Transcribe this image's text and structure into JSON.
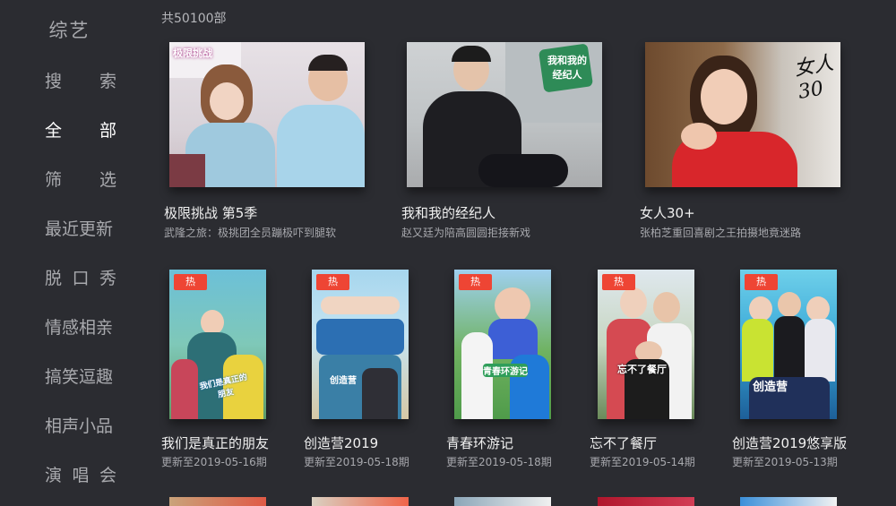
{
  "sidebar": {
    "category": "综艺",
    "items": [
      {
        "label": "搜索",
        "chars": [
          "搜",
          "索"
        ],
        "active": false
      },
      {
        "label": "全部",
        "chars": [
          "全",
          "部"
        ],
        "active": true
      },
      {
        "label": "筛选",
        "chars": [
          "筛",
          "选"
        ],
        "active": false
      },
      {
        "label": "最近更新",
        "chars": [
          "最近更新"
        ],
        "active": false
      },
      {
        "label": "脱口秀",
        "chars": [
          "脱",
          "口",
          "秀"
        ],
        "active": false
      },
      {
        "label": "情感相亲",
        "chars": [
          "情感相亲"
        ],
        "active": false
      },
      {
        "label": "搞笑逗趣",
        "chars": [
          "搞笑逗趣"
        ],
        "active": false
      },
      {
        "label": "相声小品",
        "chars": [
          "相声小品"
        ],
        "active": false
      },
      {
        "label": "演唱会",
        "chars": [
          "演",
          "唱",
          "会"
        ],
        "active": false
      }
    ]
  },
  "header": {
    "count": "共50100部"
  },
  "featured": [
    {
      "title": "极限挑战 第5季",
      "subtitle": "武隆之旅：极挑团全员蹦极吓到腿软",
      "overlay": "极限挑战"
    },
    {
      "title": "我和我的经纪人",
      "subtitle": "赵又廷为陪高圆圆拒接新戏",
      "overlay": "我和我的经纪人"
    },
    {
      "title": "女人30+",
      "subtitle": "张柏芝重回喜剧之王拍摄地竟迷路",
      "overlay": "女人30"
    }
  ],
  "posters": [
    {
      "badge": "热",
      "title": "我们是真正的朋友",
      "update": "更新至2019-05-16期",
      "overlay": "我们是真正的朋友"
    },
    {
      "badge": "热",
      "title": "创造营2019",
      "update": "更新至2019-05-18期",
      "overlay": "创造营"
    },
    {
      "badge": "热",
      "title": "青春环游记",
      "update": "更新至2019-05-18期",
      "overlay": "青春环游记"
    },
    {
      "badge": "热",
      "title": "忘不了餐厅",
      "update": "更新至2019-05-14期",
      "overlay": "忘不了餐厅"
    },
    {
      "badge": "热",
      "title": "创造营2019悠享版",
      "update": "更新至2019-05-13期",
      "overlay": "创造营"
    }
  ],
  "colors": {
    "background": "#2b2c31",
    "badge": "#ee4534",
    "active_nav": "#ffffff",
    "inactive_nav": "#a9aaae"
  }
}
